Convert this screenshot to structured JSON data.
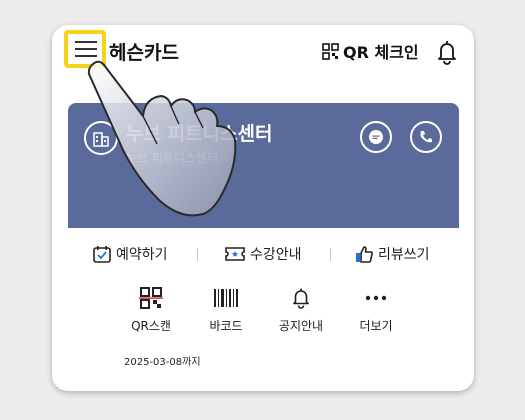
{
  "header": {
    "menu_icon": "hamburger-menu-icon",
    "title": "헤슨카드",
    "qr_checkin_label": "QR 체크인",
    "bell_icon": "bell-icon"
  },
  "card": {
    "gym_name": "누브 피트니스센터",
    "gym_sub": "누브 피트니스센터 ·",
    "bg_color": "#5a6a9a",
    "chat_icon": "chat-icon",
    "phone_icon": "phone-icon"
  },
  "actions": [
    {
      "label": "예약하기",
      "icon": "calendar-check-icon"
    },
    {
      "label": "수강안내",
      "icon": "ticket-icon"
    },
    {
      "label": "리뷰쓰기",
      "icon": "thumbs-up-icon"
    }
  ],
  "quick": [
    {
      "label": "QR스캔",
      "icon": "qr-scan-icon"
    },
    {
      "label": "바코드",
      "icon": "barcode-icon"
    },
    {
      "label": "공지안내",
      "icon": "bell-icon"
    },
    {
      "label": "더보기",
      "icon": "more-icon"
    }
  ],
  "expiry": "2025-03-08까지",
  "highlight_color": "#f6d21a"
}
